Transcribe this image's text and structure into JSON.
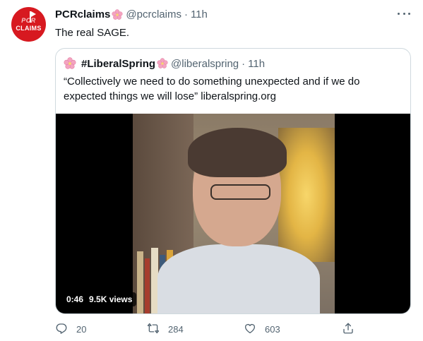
{
  "tweet": {
    "avatar_text_top": "PCR",
    "avatar_text_bottom": "CLAIMS",
    "display_name": "PCRclaims",
    "handle": "@pcrclaims",
    "separator": "·",
    "time": "11h",
    "text": "The real SAGE."
  },
  "quote": {
    "display_name": "#LiberalSpring",
    "handle": "@liberalspring",
    "separator": "·",
    "time": "11h",
    "text": "“Collectively we need to do something unexpected and if we do expected things we will lose” liberalspring.org",
    "video": {
      "duration": "0:46",
      "views": "9.5K views"
    }
  },
  "actions": {
    "reply_count": "20",
    "retweet_count": "284",
    "like_count": "603"
  },
  "icons": {
    "flower": "cherry-blossom-icon",
    "more": "more-icon",
    "reply": "reply-icon",
    "retweet": "retweet-icon",
    "like": "like-icon",
    "share": "share-icon"
  },
  "colors": {
    "avatar_bg": "#d71920",
    "muted": "#536471",
    "border": "#cfd9de",
    "flower": "#f4a3c0"
  }
}
